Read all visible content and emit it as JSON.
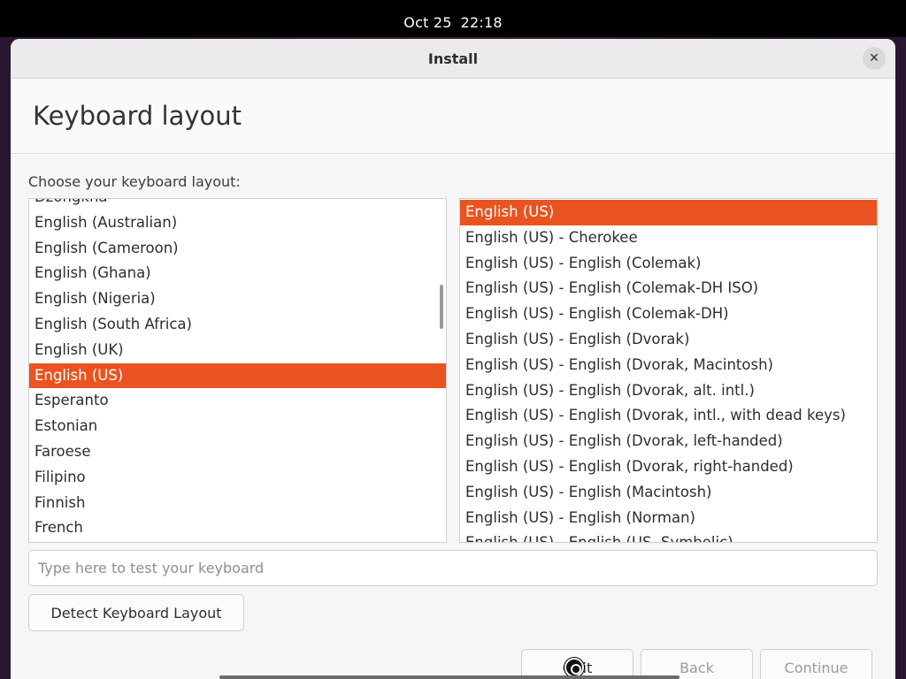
{
  "topbar": {
    "date": "Oct 25",
    "time": "22:18"
  },
  "window": {
    "title": "Install",
    "close_glyph": "✕"
  },
  "page": {
    "title": "Keyboard layout",
    "prompt": "Choose your keyboard layout:"
  },
  "layouts": {
    "items": [
      "Dzongkha",
      "English (Australian)",
      "English (Cameroon)",
      "English (Ghana)",
      "English (Nigeria)",
      "English (South Africa)",
      "English (UK)",
      "English (US)",
      "Esperanto",
      "Estonian",
      "Faroese",
      "Filipino",
      "Finnish",
      "French"
    ],
    "selected": "English (US)"
  },
  "variants": {
    "items": [
      "English (US)",
      "English (US) - Cherokee",
      "English (US) - English (Colemak)",
      "English (US) - English (Colemak-DH ISO)",
      "English (US) - English (Colemak-DH)",
      "English (US) - English (Dvorak)",
      "English (US) - English (Dvorak, Macintosh)",
      "English (US) - English (Dvorak, alt. intl.)",
      "English (US) - English (Dvorak, intl., with dead keys)",
      "English (US) - English (Dvorak, left-handed)",
      "English (US) - English (Dvorak, right-handed)",
      "English (US) - English (Macintosh)",
      "English (US) - English (Norman)",
      "English (US) - English (US, Symbolic)"
    ],
    "selected": "English (US)"
  },
  "test_field": {
    "placeholder": "Type here to test your keyboard",
    "value": ""
  },
  "buttons": {
    "detect": "Detect Keyboard Layout",
    "quit": "Quit",
    "back": "Back",
    "continue": "Continue"
  },
  "colors": {
    "accent": "#e95420"
  }
}
